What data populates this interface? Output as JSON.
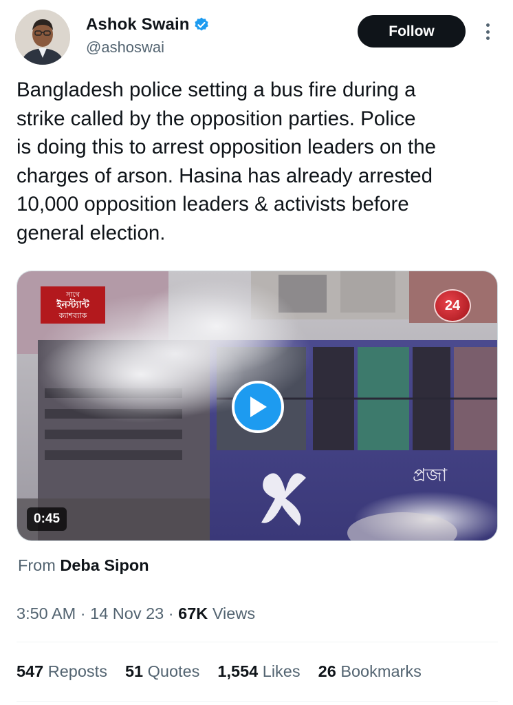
{
  "author": {
    "name": "Ashok Swain",
    "handle": "@ashoswai",
    "verified": true,
    "badge_color": "#1d9bf0"
  },
  "actions": {
    "follow_label": "Follow",
    "more_icon": "more-vertical-icon"
  },
  "tweet": {
    "text": "Bangladesh police setting a bus fire during a\nstrike called by the opposition parties. Police\nis doing this to arrest opposition leaders on the\ncharges of arson. Hasina has already arrested\n10,000 opposition leaders & activists before\ngeneral election."
  },
  "media": {
    "duration": "0:45",
    "play_icon": "play-icon",
    "channel_logo_line1": "সাথে",
    "channel_logo_line2": "ইনস্ট্যান্ট",
    "channel_logo_line3": "ক্যাশব্যাক",
    "channel_badge": "24"
  },
  "attribution": {
    "prefix": "From",
    "source": "Deba Sipon"
  },
  "meta": {
    "time": "3:50 AM",
    "date": "14 Nov 23",
    "views_count": "67K",
    "views_label": "Views"
  },
  "stats": {
    "reposts_count": "547",
    "reposts_label": "Reposts",
    "quotes_count": "51",
    "quotes_label": "Quotes",
    "likes_count": "1,554",
    "likes_label": "Likes",
    "bookmarks_count": "26",
    "bookmarks_label": "Bookmarks"
  }
}
